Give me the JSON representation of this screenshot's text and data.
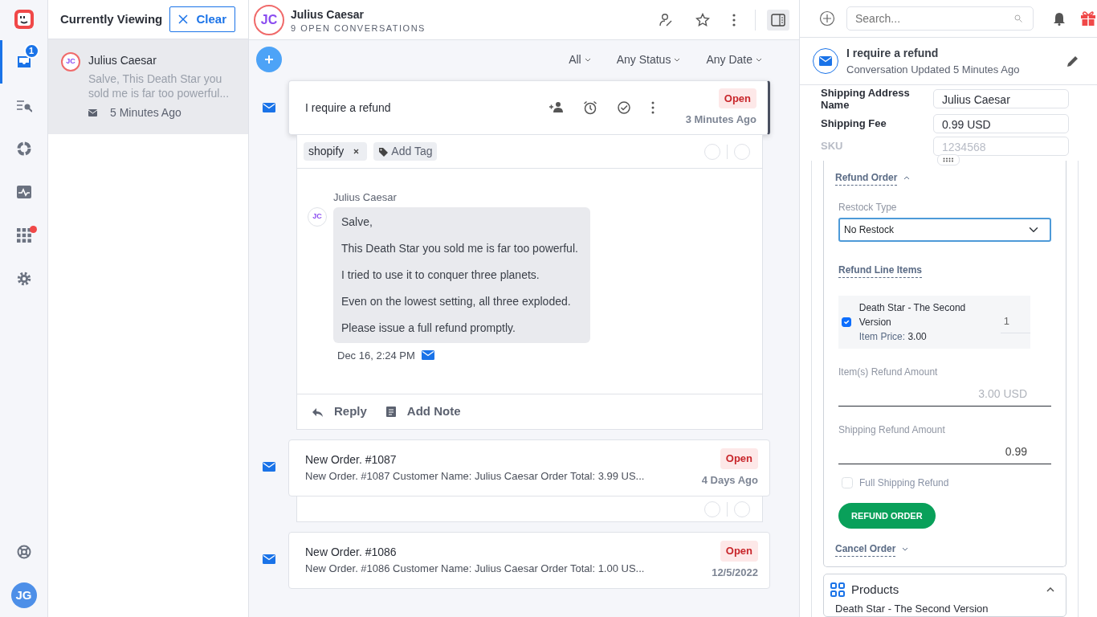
{
  "nav": {
    "items": [
      {
        "kind": "inbox",
        "selected": true,
        "badge": "1",
        "alert": false
      },
      {
        "kind": "search-list",
        "selected": false,
        "alert": false
      },
      {
        "kind": "ring",
        "selected": false,
        "alert": false
      },
      {
        "kind": "activity",
        "selected": false,
        "alert": false
      },
      {
        "kind": "apps",
        "selected": false,
        "alert": true
      },
      {
        "kind": "settings",
        "selected": false,
        "alert": false
      }
    ],
    "bottom": [
      {
        "kind": "help"
      },
      {
        "kind": "avatar",
        "initials": "JG"
      }
    ]
  },
  "list_panel": {
    "title": "Currently Viewing",
    "clear_button": "Clear",
    "items": [
      {
        "initials": "JC",
        "name": "Julius Caesar",
        "preview": "Salve, This Death Star you sold me is far too powerful...",
        "time": "5 Minutes Ago",
        "selected": true
      }
    ]
  },
  "customer": {
    "initials": "JC",
    "name": "Julius Caesar",
    "subtitle": "9 OPEN CONVERSATIONS"
  },
  "filters": [
    "All",
    "Any Status",
    "Any Date"
  ],
  "conversations": [
    {
      "subject": "I require a refund",
      "status": "Open",
      "time": "3 Minutes Ago",
      "selected": true,
      "expanded": true,
      "tags": [
        "shopify"
      ],
      "add_tag": "Add Tag",
      "messages": [
        {
          "author": "Julius Caesar",
          "initials": "JC",
          "paragraphs": [
            "Salve,",
            "This Death Star you sold me is far too powerful.",
            "I tried to use it to conquer three planets.",
            "Even on the lowest setting, all three exploded.",
            "Please issue a full refund promptly."
          ],
          "time": "Dec 16, 2:24 PM"
        }
      ],
      "actions": [
        {
          "kind": "reply",
          "label": "Reply"
        },
        {
          "kind": "note",
          "label": "Add Note"
        }
      ]
    },
    {
      "subject": "New Order. #1087",
      "preview": "New Order. #1087 Customer Name: Julius Caesar Order Total: 3.99 US...",
      "status": "Open",
      "time": "4 Days Ago",
      "selected": false,
      "expanded": false,
      "footer": true
    },
    {
      "subject": "New Order. #1086",
      "preview": "New Order. #1086 Customer Name: Julius Caesar Order Total: 1.00 US...",
      "status": "Open",
      "time": "12/5/2022",
      "selected": false,
      "expanded": false,
      "footer": false
    }
  ],
  "search": {
    "placeholder": "Search..."
  },
  "details": {
    "title": "I require a refund",
    "subtitle": "Conversation Updated 5 Minutes Ago",
    "fields": [
      {
        "label": "Shipping Address Name",
        "value": "Julius Caesar",
        "disabled": false
      },
      {
        "label": "Shipping Fee",
        "value": "0.99 USD",
        "disabled": false
      },
      {
        "label": "SKU",
        "value": "1234568",
        "disabled": true
      }
    ],
    "refund": {
      "title": "Refund Order",
      "expanded": true,
      "restock_label": "Restock Type",
      "restock_value": "No Restock",
      "line_items_title": "Refund Line Items",
      "line_items": [
        {
          "name": "Death Star - The Second Version",
          "price_label": "Item Price:",
          "price": "3.00",
          "quantity": "1",
          "checked": true
        }
      ],
      "items_amount": {
        "label": "Item(s) Refund Amount",
        "value": "3.00 USD",
        "disabled": true
      },
      "shipping_amount": {
        "label": "Shipping Refund Amount",
        "value": "0.99",
        "disabled": false
      },
      "full_shipping": {
        "label": "Full Shipping Refund",
        "checked": false
      },
      "button": "REFUND ORDER"
    },
    "cancel": {
      "title": "Cancel Order",
      "expanded": false
    },
    "products": {
      "title": "Products",
      "expanded": true,
      "items": [
        "Death Star - The Second Version"
      ]
    }
  }
}
